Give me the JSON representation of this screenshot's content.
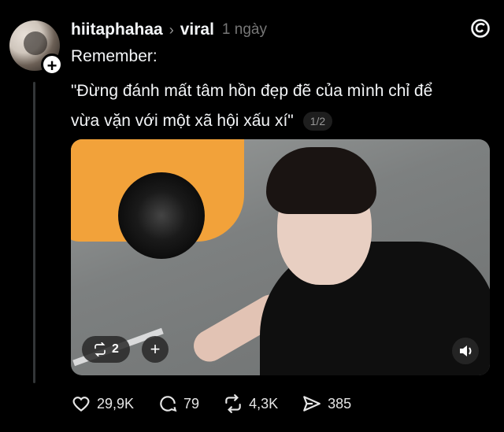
{
  "post": {
    "username": "hiitaphahaa",
    "topic": "viral",
    "time": "1 ngày",
    "text_intro": "Remember:",
    "text_line1": "\"Đừng đánh mất tâm hồn đẹp đẽ của mình chỉ để",
    "text_line2": "vừa vặn với một xã hội xấu xí\"",
    "page_indicator": "1/2"
  },
  "media": {
    "repost_count": "2"
  },
  "actions": {
    "likes": "29,9K",
    "replies": "79",
    "reposts": "4,3K",
    "shares": "385"
  },
  "icons": [
    "follow-plus-icon",
    "chevron-right-icon",
    "threads-logo-icon",
    "repost-icon",
    "plus-icon",
    "speaker-icon",
    "heart-icon",
    "comment-icon",
    "repost-icon",
    "share-icon"
  ]
}
